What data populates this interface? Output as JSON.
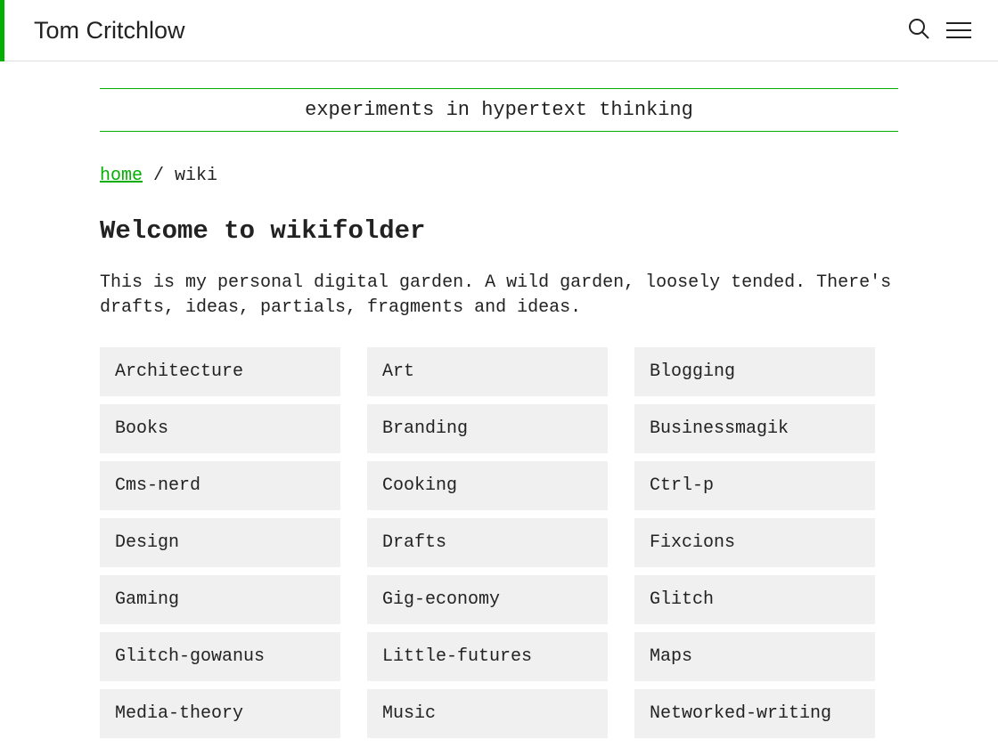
{
  "header": {
    "site_title": "Tom Critchlow"
  },
  "subtitle": "experiments in hypertext thinking",
  "breadcrumb": {
    "home_label": "home",
    "separator": " / ",
    "current": "wiki"
  },
  "page_title": "Welcome to wikifolder",
  "intro": "This is my personal digital garden. A wild garden, loosely tended. There's drafts, ideas, partials, fragments and ideas.",
  "categories": [
    {
      "label": "Architecture"
    },
    {
      "label": "Art"
    },
    {
      "label": "Blogging"
    },
    {
      "label": "Books"
    },
    {
      "label": "Branding"
    },
    {
      "label": "Businessmagik"
    },
    {
      "label": "Cms-nerd"
    },
    {
      "label": "Cooking"
    },
    {
      "label": "Ctrl-p"
    },
    {
      "label": "Design"
    },
    {
      "label": "Drafts"
    },
    {
      "label": "Fixcions"
    },
    {
      "label": "Gaming"
    },
    {
      "label": "Gig-economy"
    },
    {
      "label": "Glitch"
    },
    {
      "label": "Glitch-gowanus"
    },
    {
      "label": "Little-futures"
    },
    {
      "label": "Maps"
    },
    {
      "label": "Media-theory"
    },
    {
      "label": "Music"
    },
    {
      "label": "Networked-writing"
    }
  ]
}
